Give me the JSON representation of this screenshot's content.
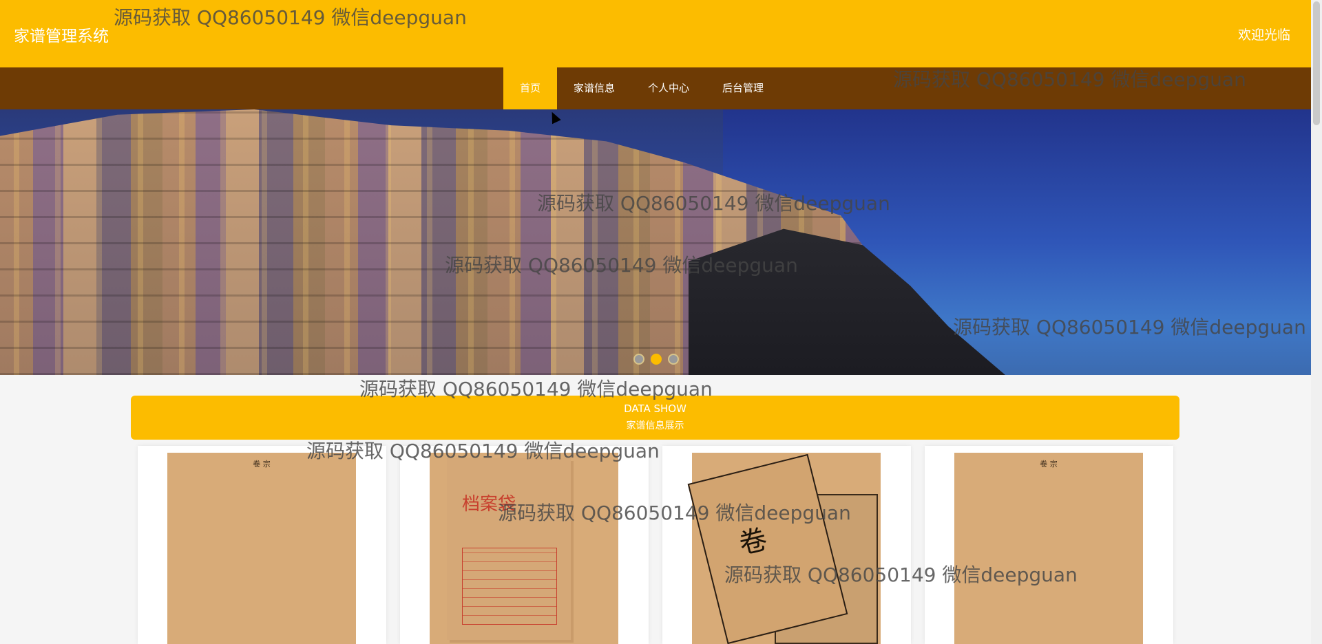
{
  "header": {
    "brand": "家谱管理系统",
    "welcome": "欢迎光临"
  },
  "nav": {
    "items": [
      {
        "label": "首页",
        "active": true
      },
      {
        "label": "家谱信息",
        "active": false
      },
      {
        "label": "个人中心",
        "active": false
      },
      {
        "label": "后台管理",
        "active": false
      }
    ]
  },
  "banner": {
    "slide_count": 3,
    "active_slide": 2
  },
  "section": {
    "title_en": "DATA SHOW",
    "title_cn": "家谱信息展示"
  },
  "cards": [
    {
      "image": "form-sheet",
      "image_text": "卷 宗"
    },
    {
      "image": "envelope",
      "image_text": "档案袋"
    },
    {
      "image": "folder",
      "image_text": "卷"
    },
    {
      "image": "form-sheet",
      "image_text": "卷 宗"
    }
  ],
  "watermark": "源码获取 QQ86050149 微信deepguan",
  "colors": {
    "accent": "#fcbc00",
    "nav_bg": "#6e3b05"
  }
}
